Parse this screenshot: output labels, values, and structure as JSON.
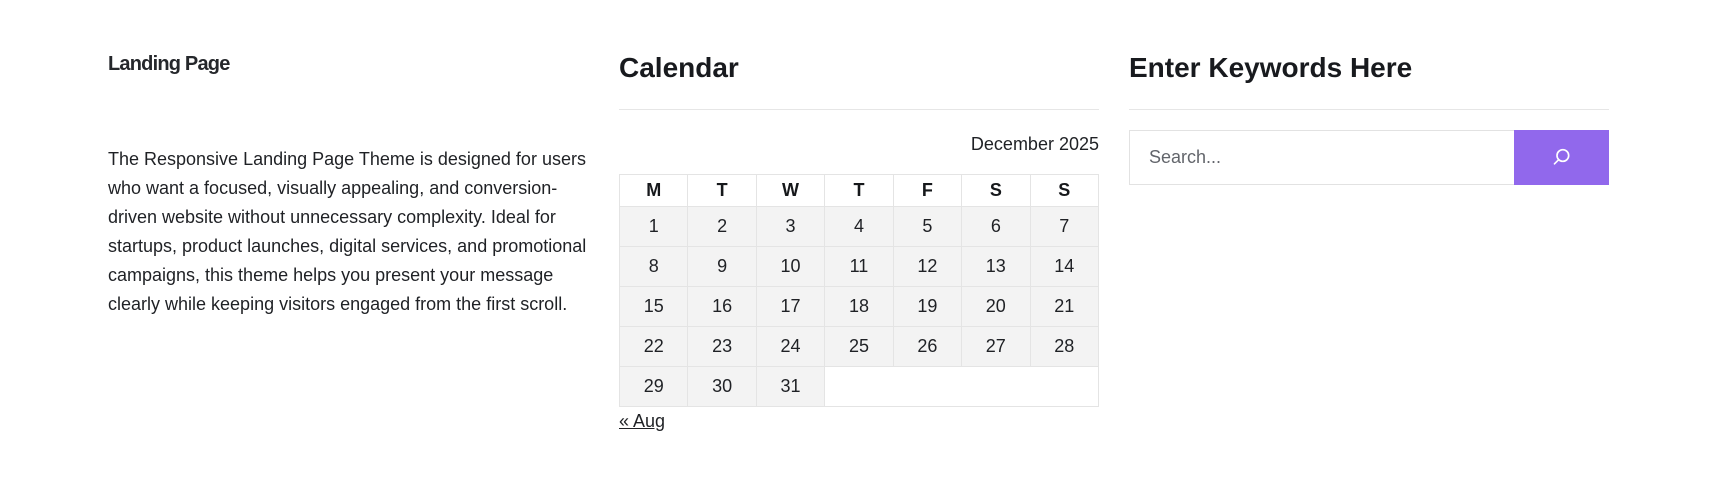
{
  "about": {
    "logo": "Landing Page",
    "description": "The Responsive Landing Page Theme is designed for users who want a focused, visually appealing, and conversion-driven website without unnecessary complexity. Ideal for startups, product launches, digital services, and promotional campaigns, this theme helps you present your message clearly while keeping visitors engaged from the first scroll."
  },
  "calendar": {
    "title": "Calendar",
    "caption": "December 2025",
    "weekdays": [
      "M",
      "T",
      "W",
      "T",
      "F",
      "S",
      "S"
    ],
    "weeks": [
      [
        "1",
        "2",
        "3",
        "4",
        "5",
        "6",
        "7"
      ],
      [
        "8",
        "9",
        "10",
        "11",
        "12",
        "13",
        "14"
      ],
      [
        "15",
        "16",
        "17",
        "18",
        "19",
        "20",
        "21"
      ],
      [
        "22",
        "23",
        "24",
        "25",
        "26",
        "27",
        "28"
      ],
      [
        "29",
        "30",
        "31",
        "",
        "",
        "",
        ""
      ]
    ],
    "previous_month": "« Aug"
  },
  "search": {
    "title": "Enter Keywords Here",
    "placeholder": "Search...",
    "value": "",
    "button_icon": "search-icon",
    "button_color": "#9168ec"
  }
}
